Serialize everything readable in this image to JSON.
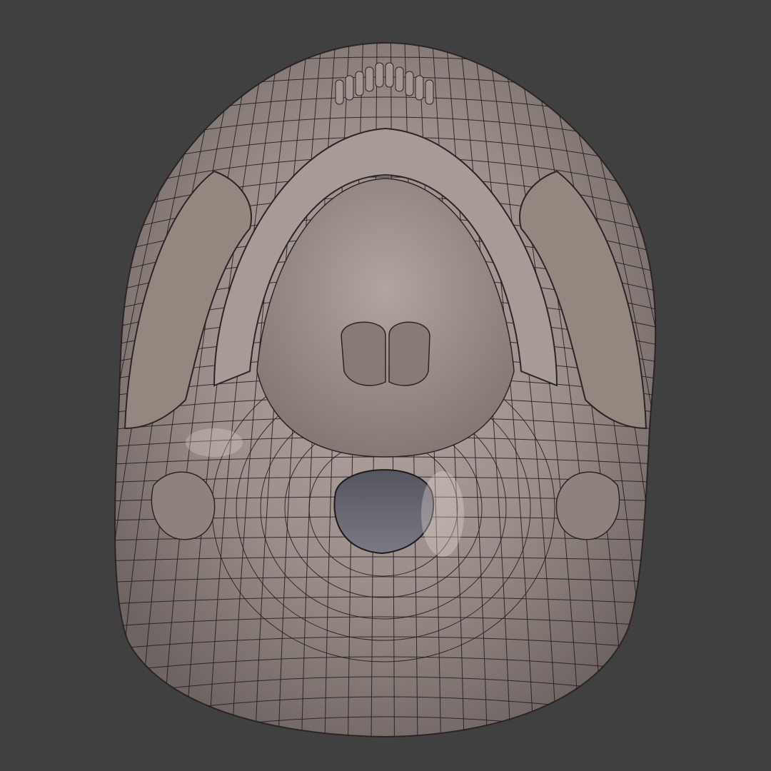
{
  "scene": {
    "background_color": "#404040",
    "model_color": "#9c8e8a",
    "wireframe_color": "#1f1a1c",
    "object_view": "skull-underside",
    "shading": "solid-with-wireframe"
  }
}
